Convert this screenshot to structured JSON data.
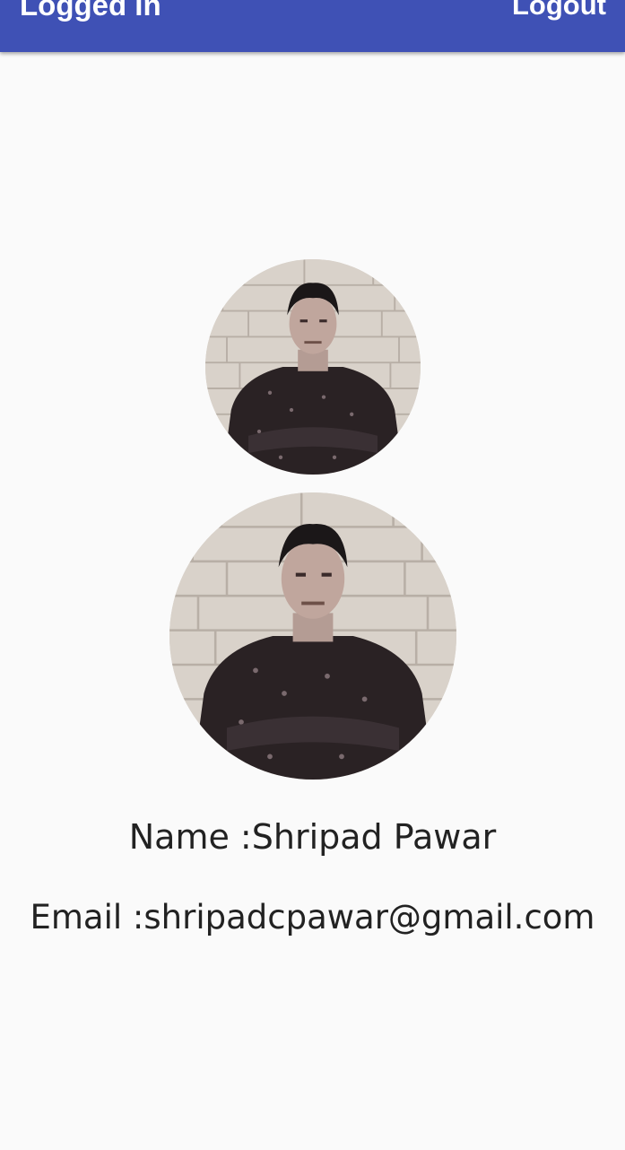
{
  "appbar": {
    "title": "Logged In",
    "logout_label": "Logout",
    "color": "#3f51b5"
  },
  "profile": {
    "photo_icon": "user-photo",
    "name_label": "Name :",
    "name_value": "Shripad Pawar",
    "email_label": "Email :",
    "email_value": "shripadcpawar@gmail.com"
  },
  "colors": {
    "background": "#fafafa",
    "text": "#222222"
  }
}
